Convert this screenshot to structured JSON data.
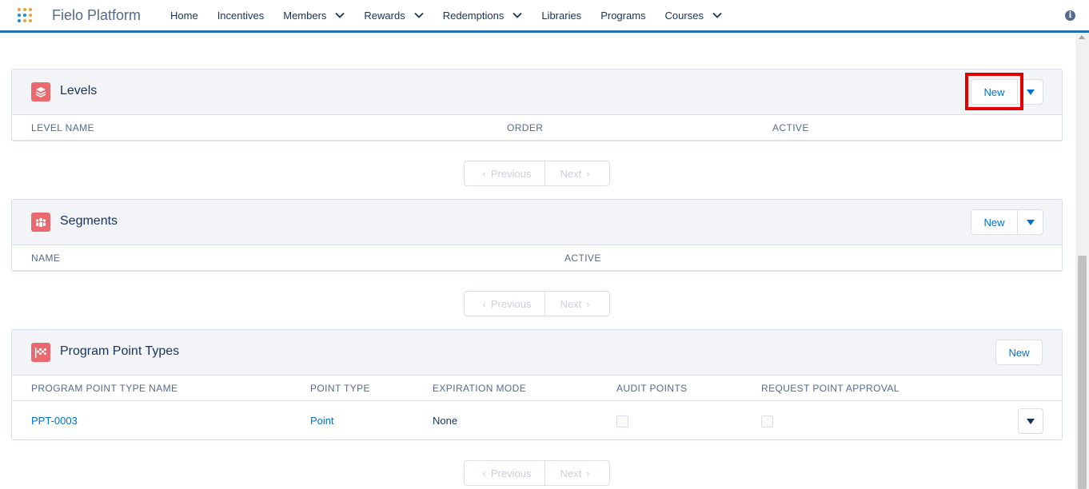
{
  "app": {
    "name": "Fielo Platform"
  },
  "nav": {
    "items": [
      {
        "label": "Home",
        "has_menu": false
      },
      {
        "label": "Incentives",
        "has_menu": false
      },
      {
        "label": "Members",
        "has_menu": true
      },
      {
        "label": "Rewards",
        "has_menu": true
      },
      {
        "label": "Redemptions",
        "has_menu": true
      },
      {
        "label": "Libraries",
        "has_menu": false
      },
      {
        "label": "Programs",
        "has_menu": false
      },
      {
        "label": "Courses",
        "has_menu": true
      }
    ]
  },
  "levels": {
    "title": "Levels",
    "new_label": "New",
    "columns": [
      "LEVEL NAME",
      "ORDER",
      "ACTIVE"
    ],
    "pager": {
      "previous": "Previous",
      "next": "Next"
    }
  },
  "segments": {
    "title": "Segments",
    "new_label": "New",
    "columns": [
      "NAME",
      "ACTIVE"
    ],
    "pager": {
      "previous": "Previous",
      "next": "Next"
    }
  },
  "point_types": {
    "title": "Program Point Types",
    "new_label": "New",
    "columns": [
      "PROGRAM POINT TYPE NAME",
      "POINT TYPE",
      "EXPIRATION MODE",
      "AUDIT POINTS",
      "REQUEST POINT APPROVAL"
    ],
    "rows": [
      {
        "name": "PPT-0003",
        "point_type": "Point",
        "expiration_mode": "None",
        "audit_points": false,
        "request_point_approval": false
      }
    ],
    "pager": {
      "previous": "Previous",
      "next": "Next"
    }
  },
  "colors": {
    "brand_blue": "#0070d2",
    "nav_underline": "#1f6fb5",
    "icon_red": "#e9696e",
    "highlight_red": "#e30000"
  }
}
